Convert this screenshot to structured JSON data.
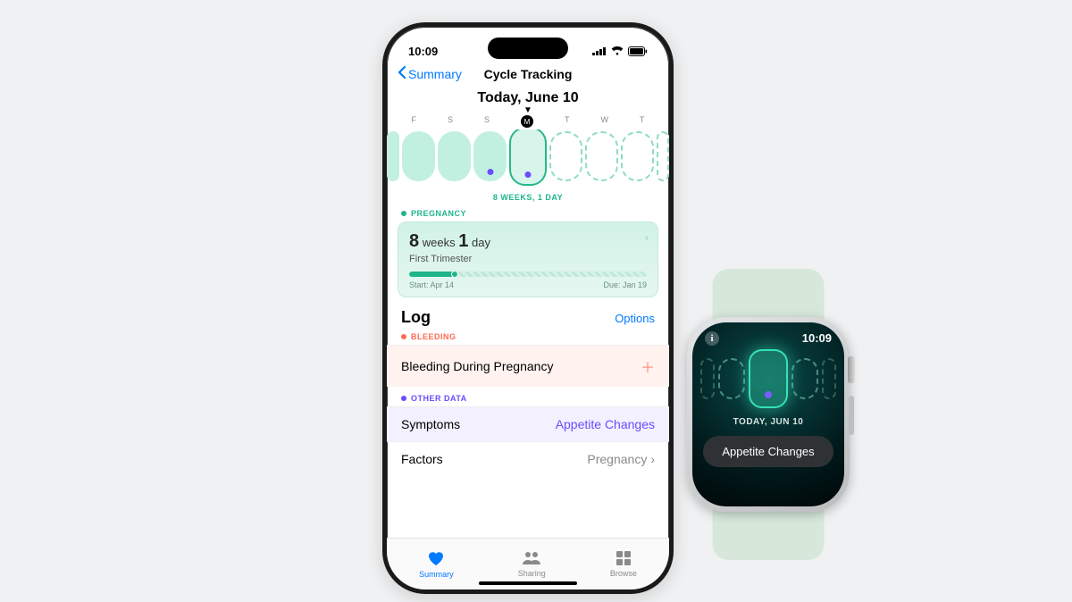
{
  "phone": {
    "status": {
      "time": "10:09"
    },
    "nav": {
      "back": "Summary",
      "title": "Cycle Tracking"
    },
    "today_heading": "Today, June 10",
    "weekdays": [
      "F",
      "S",
      "S",
      "M",
      "T",
      "W",
      "T"
    ],
    "cycle_caption": "8 WEEKS, 1 DAY",
    "pregnancy": {
      "section_label": "PREGNANCY",
      "weeks_num": "8",
      "weeks_label": "weeks",
      "days_num": "1",
      "days_label": "day",
      "sub": "First Trimester",
      "start_label": "Start: Apr 14",
      "due_label": "Due: Jan 19"
    },
    "log": {
      "title": "Log",
      "options": "Options",
      "bleeding_label": "BLEEDING",
      "bleeding_row": "Bleeding During Pregnancy",
      "other_label": "OTHER DATA",
      "symptoms_label": "Symptoms",
      "symptoms_value": "Appetite Changes",
      "factors_label": "Factors",
      "factors_value": "Pregnancy"
    },
    "tabs": {
      "summary": "Summary",
      "sharing": "Sharing",
      "browse": "Browse"
    }
  },
  "watch": {
    "time": "10:09",
    "date": "TODAY, JUN 10",
    "chip": "Appetite Changes"
  }
}
